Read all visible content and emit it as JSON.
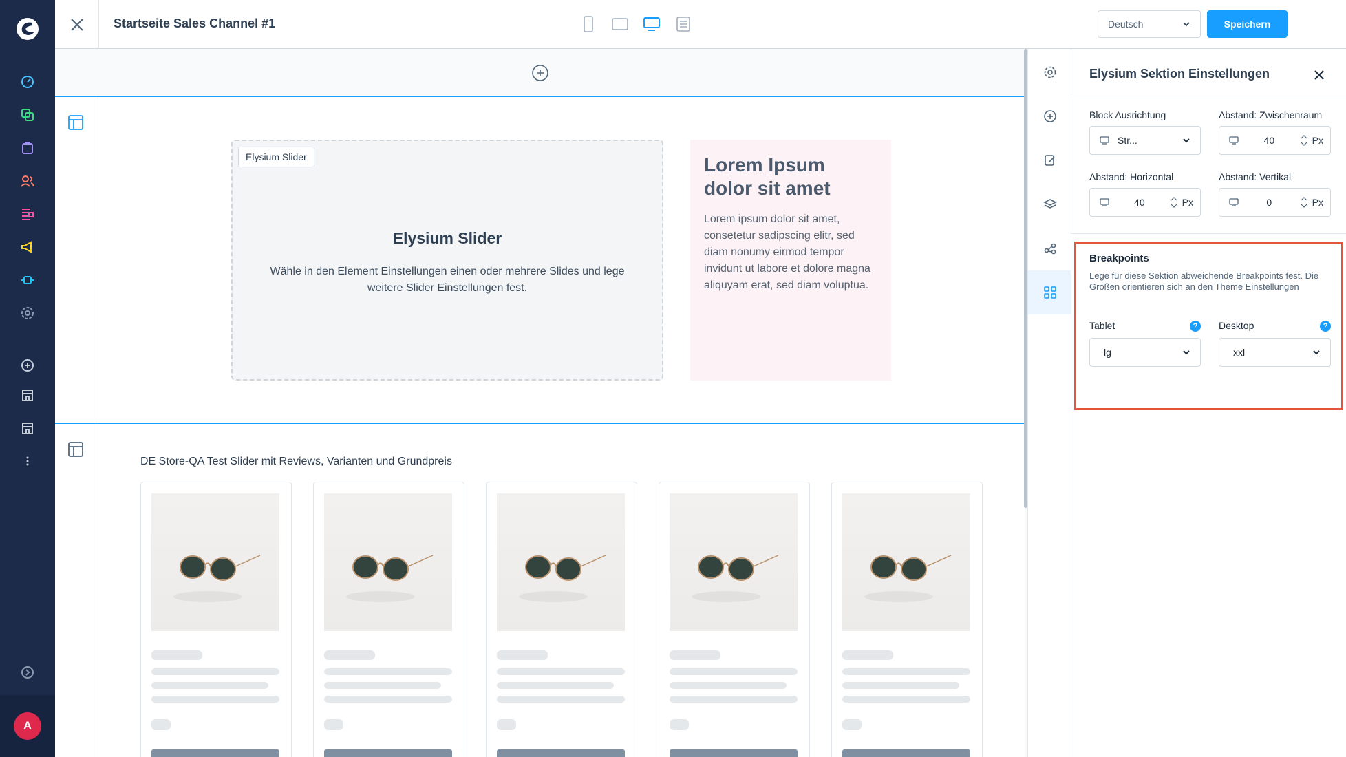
{
  "header": {
    "title": "Startseite Sales Channel #1",
    "language": "Deutsch",
    "save_label": "Speichern"
  },
  "canvas": {
    "slider_tag": "Elysium Slider",
    "slider_heading": "Elysium Slider",
    "slider_desc": "Wähle in den Element Einstellungen einen oder mehrere Slides und lege weitere Slider Einstellungen fest.",
    "text_heading": "Lorem Ipsum dolor sit amet",
    "text_body": "Lorem ipsum dolor sit amet, consetetur sadipscing elitr, sed diam nonumy eirmod tempor invidunt ut labore et dolore magna aliquyam erat, sed diam voluptua.",
    "product_slider_title": "DE Store-QA Test Slider mit Reviews, Varianten und Grundpreis"
  },
  "panel": {
    "title": "Elysium Sektion Einstellungen",
    "block_alignment_label": "Block Ausrichtung",
    "block_alignment_value": "Str...",
    "gap_label": "Abstand: Zwischenraum",
    "gap_value": "40",
    "horizontal_label": "Abstand: Horizontal",
    "horizontal_value": "40",
    "vertical_label": "Abstand: Vertikal",
    "vertical_value": "0",
    "unit": "Px",
    "breakpoints_title": "Breakpoints",
    "breakpoints_desc": "Lege für diese Sektion abweichende Breakpoints fest. Die Größen orientieren sich an den Theme Einstellungen",
    "tablet_label": "Tablet",
    "tablet_value": "lg",
    "desktop_label": "Desktop",
    "desktop_value": "xxl",
    "help_glyph": "?"
  },
  "user": {
    "avatar_letter": "A"
  },
  "colors": {
    "accent": "#189eff",
    "sidebar": "#1c2b4a",
    "highlight": "#e5553c"
  }
}
